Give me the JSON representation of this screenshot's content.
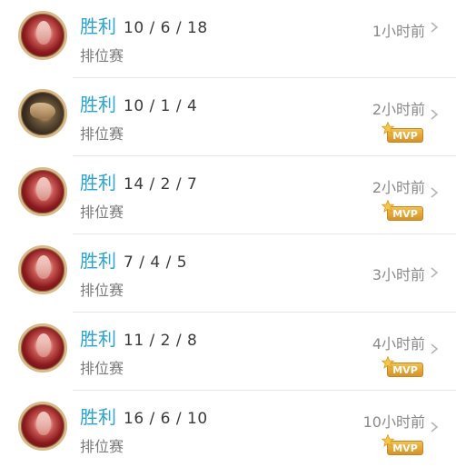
{
  "matches": [
    {
      "avatar": "red-hooded-champion",
      "result": "胜利",
      "kda": "10 / 6 / 18",
      "mode": "排位赛",
      "time": "1小时前",
      "mvp": false
    },
    {
      "avatar": "dark-armored-champion",
      "result": "胜利",
      "kda": "10 / 1 / 4",
      "mode": "排位赛",
      "time": "2小时前",
      "mvp": true,
      "mvp_label": "MVP"
    },
    {
      "avatar": "red-hooded-champion",
      "result": "胜利",
      "kda": "14 / 2 / 7",
      "mode": "排位赛",
      "time": "2小时前",
      "mvp": true,
      "mvp_label": "MVP"
    },
    {
      "avatar": "red-hooded-champion",
      "result": "胜利",
      "kda": "7 / 4 / 5",
      "mode": "排位赛",
      "time": "3小时前",
      "mvp": false
    },
    {
      "avatar": "red-hooded-champion",
      "result": "胜利",
      "kda": "11 / 2 / 8",
      "mode": "排位赛",
      "time": "4小时前",
      "mvp": true,
      "mvp_label": "MVP"
    },
    {
      "avatar": "red-hooded-champion",
      "result": "胜利",
      "kda": "16 / 6 / 10",
      "mode": "排位赛",
      "time": "10小时前",
      "mvp": true,
      "mvp_label": "MVP"
    }
  ],
  "colors": {
    "result": "#2aa4d3",
    "mvp_badge": "#e0a83a"
  },
  "icons": {
    "chevron": "chevron-right-icon",
    "mvp_star": "star-icon"
  }
}
